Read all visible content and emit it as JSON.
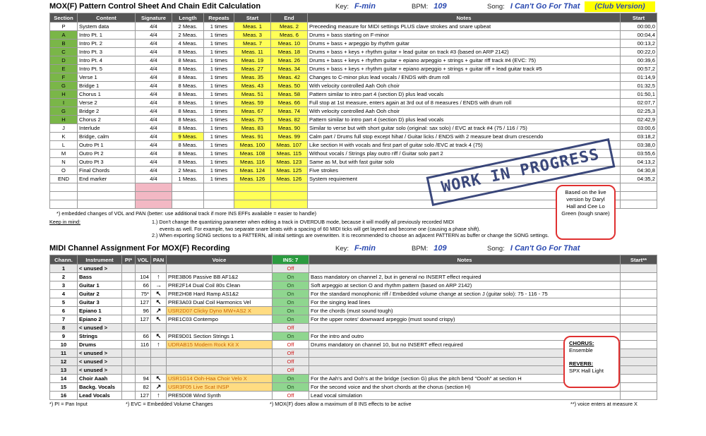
{
  "header1": {
    "title": "MOX(F) Pattern Control Sheet And Chain Edit Calculation",
    "key_label": "Key:",
    "key": "F-min",
    "bpm_label": "BPM:",
    "bpm": "109",
    "song_label": "Song:",
    "song": "I Can't Go For That",
    "club": "(Club Version)"
  },
  "t1cols": [
    "Section",
    "Content",
    "Signature",
    "Length",
    "Repeats",
    "Start",
    "End",
    "Notes",
    "Start"
  ],
  "rows1": [
    [
      "P",
      "System data",
      "4/4",
      "2 Meas.",
      "1 times",
      "Meas. 1",
      "Meas. 2",
      "Preceeding measure for MIDI settings PLUS clave strokes and snare upbeat",
      "00:00,0",
      false
    ],
    [
      "A",
      "Intro Pt. 1",
      "4/4",
      "2 Meas.",
      "1 times",
      "Meas. 3",
      "Meas. 6",
      "Drums + bass starting on F-minor",
      "00:04,4",
      true
    ],
    [
      "B",
      "Intro Pt. 2",
      "4/4",
      "4 Meas.",
      "1 times",
      "Meas. 7",
      "Meas. 10",
      "Drums + bass + arpeggio by rhythm guitar",
      "00:13,2",
      true
    ],
    [
      "C",
      "Intro Pt. 3",
      "4/4",
      "8 Meas.",
      "1 times",
      "Meas. 11",
      "Meas. 18",
      "Drums + bass + keys + rhythm guitar + lead guitar on track #3 (based on ARP 2142)",
      "00:22,0",
      true
    ],
    [
      "D",
      "Intro Pt. 4",
      "4/4",
      "8 Meas.",
      "1 times",
      "Meas. 19",
      "Meas. 26",
      "Drums + bass + keys + rhythm guitar + epiano arpeggio + strings + guitar riff track #4 (EVC: 75)",
      "00:39,6",
      true
    ],
    [
      "E",
      "Intro Pt. 5",
      "4/4",
      "8 Meas.",
      "1 times",
      "Meas. 27",
      "Meas. 34",
      "Drums + bass + keys + rhythm guitar + epiano arpeggio + strings + guitar riff + lead guitar track #5",
      "00:57,2",
      true
    ],
    [
      "F",
      "Verse 1",
      "4/4",
      "8 Meas.",
      "1 times",
      "Meas. 35",
      "Meas. 42",
      "Changes to C-minor plus lead vocals / ENDS with drum roll",
      "01:14,9",
      true
    ],
    [
      "G",
      "Bridge 1",
      "4/4",
      "8 Meas.",
      "1 times",
      "Meas. 43",
      "Meas. 50",
      "With velocity controlled Aah Ooh choir",
      "01:32,5",
      true
    ],
    [
      "H",
      "Chorus 1",
      "4/4",
      "8 Meas.",
      "1 times",
      "Meas. 51",
      "Meas. 58",
      "Pattern similar to intro part 4 (section D) plus lead vocals",
      "01:50,1",
      true
    ],
    [
      "I",
      "Verse 2",
      "4/4",
      "8 Meas.",
      "1 times",
      "Meas. 59",
      "Meas. 66",
      "Full stop at 1st measure, enters again at 3rd out of 8 measures / ENDS with drum roll",
      "02:07,7",
      true
    ],
    [
      "G",
      "Bridge 2",
      "4/4",
      "8 Meas.",
      "1 times",
      "Meas. 67",
      "Meas. 74",
      "With velocity controlled Aah Ooh choir",
      "02:25,3",
      true
    ],
    [
      "H",
      "Chorus 2",
      "4/4",
      "8 Meas.",
      "1 times",
      "Meas. 75",
      "Meas. 82",
      "Pattern similar to intro part 4 (section D) plus lead vocals",
      "02:42,9",
      true
    ],
    [
      "J",
      "Interlude",
      "4/4",
      "8 Meas.",
      "1 times",
      "Meas. 83",
      "Meas. 90",
      "Similar to verse but with short guitar solo (original: sax solo) / EVC at track #4 (75 / 116 / 75)",
      "03:00,6",
      false
    ],
    [
      "K",
      "Bridge, calm",
      "4/4",
      "9 Meas.",
      "1 times",
      "Meas. 91",
      "Meas. 99",
      "Calm part / Drums full stop except hihat / Guitar licks / ENDS with 2 measure beat drum crescendo",
      "03:18,2",
      false
    ],
    [
      "L",
      "Outro Pt 1",
      "4/4",
      "8 Meas.",
      "1 times",
      "Meas. 100",
      "Meas. 107",
      "Like section H with vocals and first part of guitar solo /EVC at track 4 (75)",
      "03:38,0",
      false
    ],
    [
      "M",
      "Outro Pt 2",
      "4/4",
      "8 Meas.",
      "1 times",
      "Meas. 108",
      "Meas. 115",
      "Without vocals / Strings play outro riff / Guitar solo part 2",
      "03:55,6",
      false
    ],
    [
      "N",
      "Outro Pt 3",
      "4/4",
      "8 Meas.",
      "1 times",
      "Meas. 116",
      "Meas. 123",
      "Same as M, but with fast guitar solo",
      "04:13,2",
      false
    ],
    [
      "O",
      "Final Chords",
      "4/4",
      "2 Meas.",
      "1 times",
      "Meas. 124",
      "Meas. 125",
      "Five strokes",
      "04:30,8",
      false
    ],
    [
      "END",
      "End marker",
      "4/4",
      "1 Meas.",
      "1 times",
      "Meas. 126",
      "Meas. 126",
      "System requirement",
      "04:35,2",
      false
    ]
  ],
  "footnote1": "*) embedded changes of VOL and PAN (better: use additional track if more INS EFFs available = easier to handle)",
  "keep": {
    "label": "Keep in mind:",
    "l1": "1.) Don't change the quantizing parameter when editing a track in OVERDUB mode, because it will modify all previously recorded MIDI",
    "l1b": "events as well. For example, two separate snare beats with a spacing of 60 MIDI ticks will get layered and become one (causing a phase shift).",
    "l2": "2.) When exporting SONG sections to a PATTERN, all inital settings are overwritten. It is recommended to choose an adjacent PATTERN as buffer or change the SONG settings."
  },
  "wip": "WORK IN PROGRESS",
  "bubble1": "Based on the live version by Daryl Hall and Cee Lo Green (tough snare)",
  "header2": {
    "title": "MIDI Channel Assignment For MOX(F) Recording",
    "key_label": "Key:",
    "key": "F-min",
    "bpm_label": "BPM:",
    "bpm": "109",
    "song_label": "Song:",
    "song": "I Can't Go For That"
  },
  "t2cols": [
    "Chann.",
    "Instrument",
    "PI*",
    "VOL",
    "PAN",
    "Voice",
    "INS: 7",
    "Notes",
    "Start**"
  ],
  "rows2": [
    [
      "1",
      "< unused >",
      "",
      "",
      "",
      "",
      "Off",
      "",
      ""
    ],
    [
      "2",
      "Bass",
      "",
      "104",
      "↑",
      "PRE3B06 Passive BB AF1&2",
      "On",
      "Bass mandatory on channel 2, but in general no INSERT effect required",
      ""
    ],
    [
      "3",
      "Guitar 1",
      "",
      "66",
      "→",
      "PRE2F14 Dual Coil 80s Clean",
      "On",
      "Soft arpeggio at section O and rhythm pattern (based on ARP 2142)",
      ""
    ],
    [
      "4",
      "Guitar 2",
      "",
      "75*",
      "↖",
      "PRE2H08 Hard Ramp AS1&2",
      "On",
      "For the standard monophonic riff / Embedded volume change at section J (guitar solo): 75 - 116 - 75",
      ""
    ],
    [
      "5",
      "Guitar 3",
      "",
      "127",
      "↖",
      "PRE3A03 Dual Coil Harmonics Vel",
      "On",
      "For the singing lead lines",
      ""
    ],
    [
      "6",
      "Epiano 1",
      "",
      "96",
      "↗",
      "USR2D07 Clicky Dyno MW+AS2 X",
      "On",
      "For the chords (must sound tough)",
      ""
    ],
    [
      "7",
      "Epiano 2",
      "",
      "127",
      "↖",
      "PRE1C03 Contempo",
      "On",
      "For the upper notes' downward arpeggio (must sound crispy)",
      ""
    ],
    [
      "8",
      "< unused >",
      "",
      "",
      "",
      "",
      "Off",
      "",
      ""
    ],
    [
      "9",
      "Strings",
      "",
      "66",
      "↖",
      "PRE9D01 Section Strings 1",
      "On",
      "For the intro and outro",
      ""
    ],
    [
      "10",
      "Drums",
      "",
      "116",
      "↑",
      "UDRAB15 Modern Rock Kit X",
      "Off",
      "Drums mandatory on channel 10, but no INSERT effect required",
      ""
    ],
    [
      "11",
      "< unused >",
      "",
      "",
      "",
      "",
      "Off",
      "",
      ""
    ],
    [
      "12",
      "< unused >",
      "",
      "",
      "",
      "",
      "Off",
      "",
      ""
    ],
    [
      "13",
      "< unused >",
      "",
      "",
      "",
      "",
      "Off",
      "",
      ""
    ],
    [
      "14",
      "Choir Aaah",
      "",
      "94",
      "↖",
      "USR1G14 Ooh-Haa Choir Velo X",
      "On",
      "For the Aah's and Ooh's at the bridge (section G) plus the pitch bend \"Oooh\" at section H",
      ""
    ],
    [
      "15",
      "Backg. Vocals",
      "",
      "82",
      "↗",
      "USR3F05 Live Scat INSP",
      "On",
      "For the second voice and the short chords at the chorus (section H)",
      ""
    ],
    [
      "16",
      "Lead Vocals",
      "",
      "127",
      "↑",
      "PRE5D08 Wind Synth",
      "Off",
      "Lead vocal simulation",
      ""
    ]
  ],
  "bubble2": {
    "chorus_label": "CHORUS:",
    "chorus": "Ensemble",
    "reverb_label": "REVERB:",
    "reverb": "SPX Hall Light"
  },
  "foot2": {
    "a": "*) PI = Pan Input",
    "b": "*) EVC = Embedded Volume Changes",
    "c": "*) MOX(F) does allow a maximum of 8 INS effects to be active",
    "d": "**) voice enters at measure X"
  },
  "colors": {
    "header": "#555555",
    "section_green": "#7ab648",
    "yellow": "#ffff57",
    "pink": "#f3b8c4",
    "ins_on": "#8fd68f",
    "orange": "#ffdc82"
  }
}
